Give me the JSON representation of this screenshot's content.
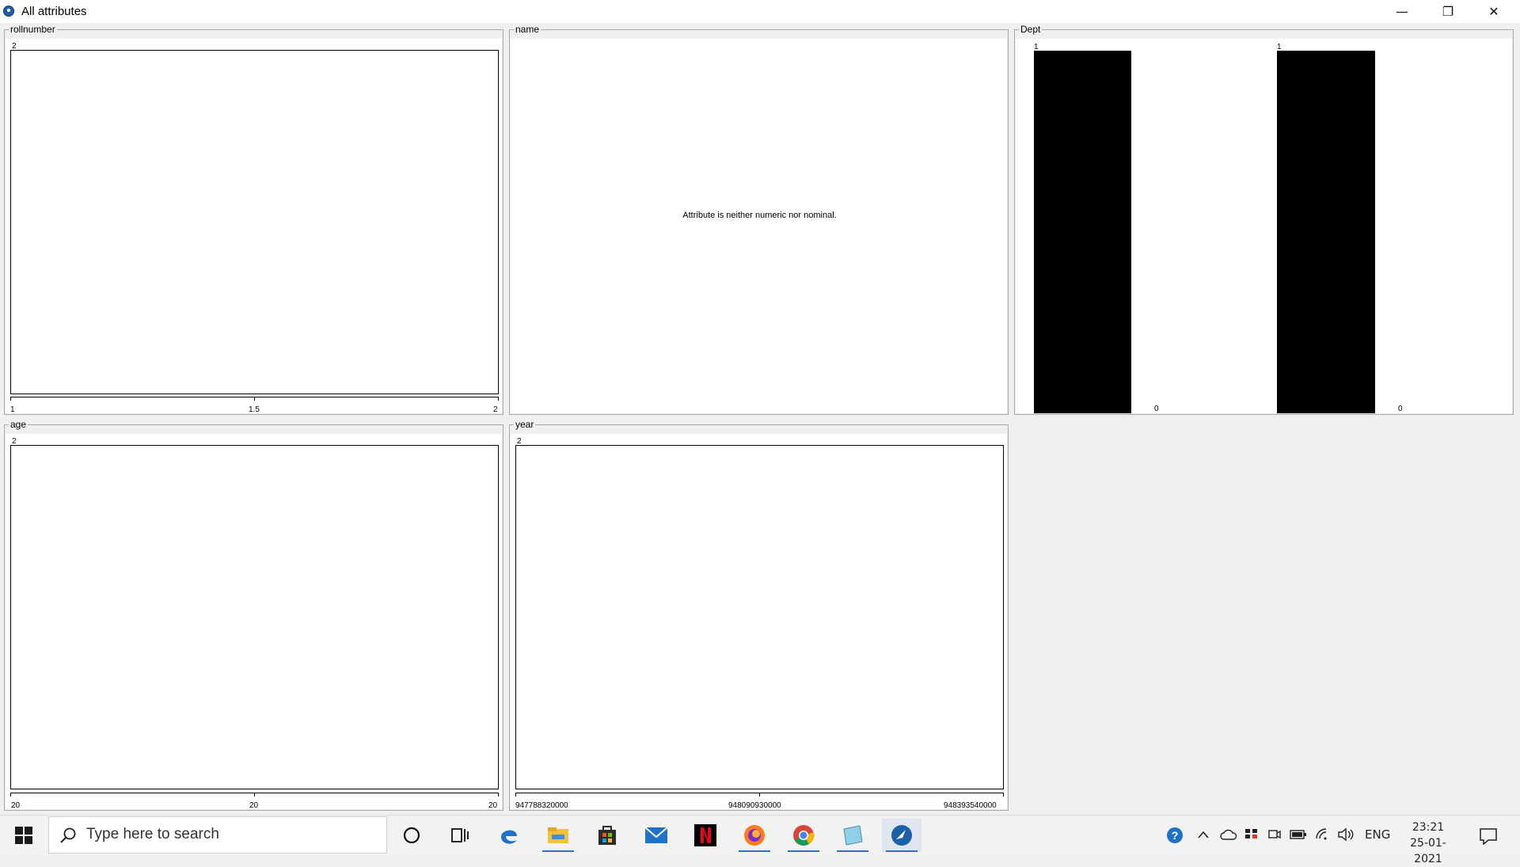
{
  "window": {
    "title": "All attributes",
    "minimize_glyph": "—",
    "restore_glyph": "❐",
    "close_glyph": "✕"
  },
  "panels": {
    "rollnumber": {
      "title": "rollnumber",
      "ymax_label": "2",
      "x_labels": [
        "1",
        "1.5",
        "2"
      ]
    },
    "name": {
      "title": "name",
      "message": "Attribute is neither numeric nor nominal."
    },
    "dept": {
      "title": "Dept",
      "bars": [
        {
          "count": 1,
          "top_label": "1",
          "bottom_label": "0"
        },
        {
          "count": 1,
          "top_label": "1",
          "bottom_label": "0"
        }
      ]
    },
    "age": {
      "title": "age",
      "ymax_label": "2",
      "x_labels": [
        "20",
        "20",
        "20"
      ]
    },
    "year": {
      "title": "year",
      "ymax_label": "2",
      "x_labels": [
        "947788320000",
        "948090930000",
        "948393540000"
      ]
    }
  },
  "taskbar": {
    "search_placeholder": "Type here to search",
    "apps": [
      "cortana-icon",
      "task-view-icon",
      "edge-icon",
      "file-explorer-icon",
      "store-icon",
      "mail-icon",
      "netflix-icon",
      "firefox-icon",
      "chrome-icon",
      "notepad-icon",
      "weka-icon"
    ],
    "language": "ENG",
    "time": "23:21",
    "date": "25-01-2021"
  },
  "colors": {
    "accent": "#2a6fd6",
    "bar": "#000000",
    "panel_bg": "#ffffff"
  }
}
